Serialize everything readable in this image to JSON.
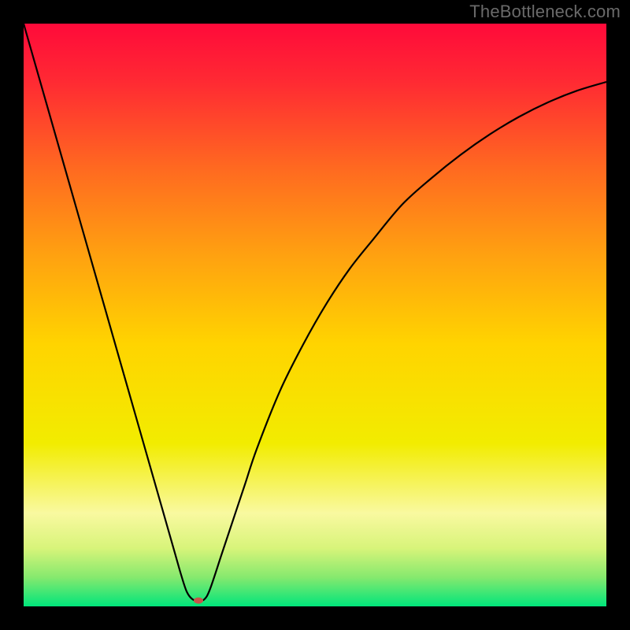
{
  "watermark": "TheBottleneck.com",
  "chart_data": {
    "type": "line",
    "title": "",
    "xlabel": "",
    "ylabel": "",
    "xlim": [
      0,
      100
    ],
    "ylim": [
      0,
      100
    ],
    "grid": false,
    "legend": false,
    "annotations": [],
    "background": {
      "type": "vertical-gradient",
      "stops": [
        {
          "pos": 0.0,
          "color": "#ff0a3a"
        },
        {
          "pos": 0.1,
          "color": "#ff2a33"
        },
        {
          "pos": 0.25,
          "color": "#ff6a20"
        },
        {
          "pos": 0.4,
          "color": "#ffa210"
        },
        {
          "pos": 0.55,
          "color": "#ffd400"
        },
        {
          "pos": 0.72,
          "color": "#f2ec00"
        },
        {
          "pos": 0.84,
          "color": "#f9f9a0"
        },
        {
          "pos": 0.9,
          "color": "#d8f47a"
        },
        {
          "pos": 0.95,
          "color": "#86e96e"
        },
        {
          "pos": 1.0,
          "color": "#00e57b"
        }
      ]
    },
    "series": [
      {
        "name": "curve",
        "color": "#000000",
        "x": [
          0,
          2,
          4,
          6,
          8,
          10,
          12,
          14,
          16,
          18,
          20,
          22,
          24,
          26,
          27,
          28,
          29,
          30,
          31,
          32,
          34,
          36,
          38,
          40,
          44,
          48,
          52,
          56,
          60,
          65,
          70,
          75,
          80,
          85,
          90,
          95,
          100
        ],
        "y": [
          100,
          93,
          86,
          79,
          72,
          65,
          58,
          51,
          44,
          37,
          30,
          23,
          16,
          9,
          5.5,
          2.5,
          1.2,
          1.0,
          1.2,
          3,
          9,
          15,
          21,
          27,
          37,
          45,
          52,
          58,
          63,
          69,
          73.5,
          77.5,
          81,
          84,
          86.5,
          88.5,
          90
        ]
      }
    ],
    "marker": {
      "name": "minimum-dot",
      "x": 30,
      "y": 1.0,
      "color": "#c9544a",
      "rx": 6,
      "ry": 4
    }
  }
}
